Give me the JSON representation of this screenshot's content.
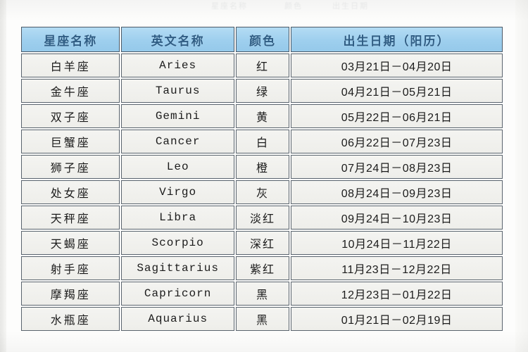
{
  "page": {
    "ghost_top_row": [
      "星座名称",
      "颜色",
      "出生日期"
    ]
  },
  "table": {
    "headers": {
      "name": "星座名称",
      "english": "英文名称",
      "color": "颜色",
      "date": "出生日期（阳历）"
    },
    "rows": [
      {
        "name": "白羊座",
        "english": "Aries",
        "color": "红",
        "date": "03月21日－04月20日"
      },
      {
        "name": "金牛座",
        "english": "Taurus",
        "color": "绿",
        "date": "04月21日－05月21日"
      },
      {
        "name": "双子座",
        "english": "Gemini",
        "color": "黄",
        "date": "05月22日－06月21日"
      },
      {
        "name": "巨蟹座",
        "english": "Cancer",
        "color": "白",
        "date": "06月22日－07月23日"
      },
      {
        "name": "狮子座",
        "english": "Leo",
        "color": "橙",
        "date": "07月24日－08月23日"
      },
      {
        "name": "处女座",
        "english": "Virgo",
        "color": "灰",
        "date": "08月24日－09月23日"
      },
      {
        "name": "天秤座",
        "english": "Libra",
        "color": "淡红",
        "date": "09月24日－10月23日"
      },
      {
        "name": "天蝎座",
        "english": "Scorpio",
        "color": "深红",
        "date": "10月24日－11月22日"
      },
      {
        "name": "射手座",
        "english": "Sagittarius",
        "color": "紫红",
        "date": "11月23日－12月22日"
      },
      {
        "name": "摩羯座",
        "english": "Capricorn",
        "color": "黑",
        "date": "12月23日－01月22日"
      },
      {
        "name": "水瓶座",
        "english": "Aquarius",
        "color": "黑",
        "date": "01月21日－02月19日"
      }
    ]
  },
  "colors": {
    "header_blue": "#9ecfee",
    "header_text": "#2f5d84",
    "cell_background": "#f1f1ee",
    "border": "#5a646e",
    "page_background": "#fdfdfc"
  }
}
